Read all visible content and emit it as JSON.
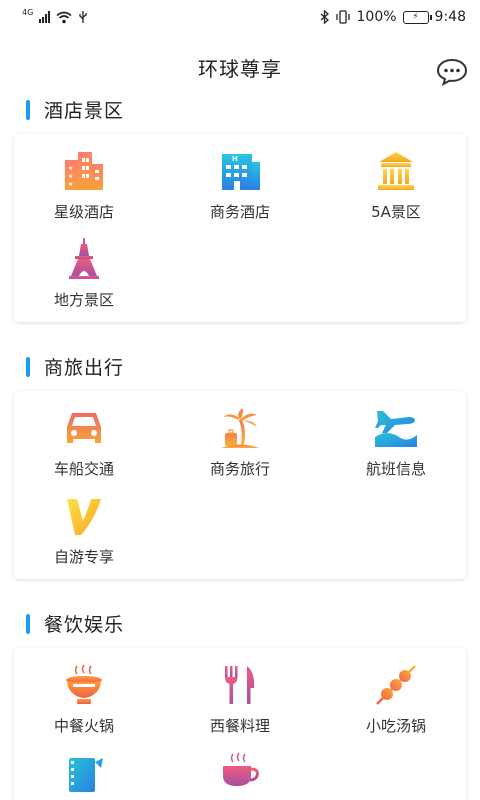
{
  "status_bar": {
    "network": "4G",
    "battery": "100%",
    "time": "9:48"
  },
  "header": {
    "title": "环球尊享",
    "message_icon": "chat-bubble-icon"
  },
  "sections": [
    {
      "title": "酒店景区",
      "items": [
        {
          "label": "星级酒店",
          "icon": "star-hotel-icon"
        },
        {
          "label": "商务酒店",
          "icon": "business-hotel-icon"
        },
        {
          "label": "5A景区",
          "icon": "temple-icon"
        },
        {
          "label": "地方景区",
          "icon": "tower-icon"
        }
      ]
    },
    {
      "title": "商旅出行",
      "items": [
        {
          "label": "车船交通",
          "icon": "car-icon"
        },
        {
          "label": "商务旅行",
          "icon": "palm-luggage-icon"
        },
        {
          "label": "航班信息",
          "icon": "plane-icon"
        },
        {
          "label": "自游专享",
          "icon": "v-icon"
        }
      ]
    },
    {
      "title": "餐饮娱乐",
      "items": [
        {
          "label": "中餐火锅",
          "icon": "hotpot-icon"
        },
        {
          "label": "西餐料理",
          "icon": "fork-knife-icon"
        },
        {
          "label": "小吃汤锅",
          "icon": "skewer-icon"
        },
        {
          "label": "",
          "icon": "film-icon"
        },
        {
          "label": "",
          "icon": "coffee-cup-icon"
        }
      ]
    }
  ],
  "colors": {
    "accent_bar": "#1f9cf0",
    "orange": "#f5a623",
    "pink": "#e8567c",
    "blue": "#2b8fe3",
    "cyan": "#27c3d8",
    "yellow": "#f7c62b",
    "purple": "#b14fa0"
  }
}
